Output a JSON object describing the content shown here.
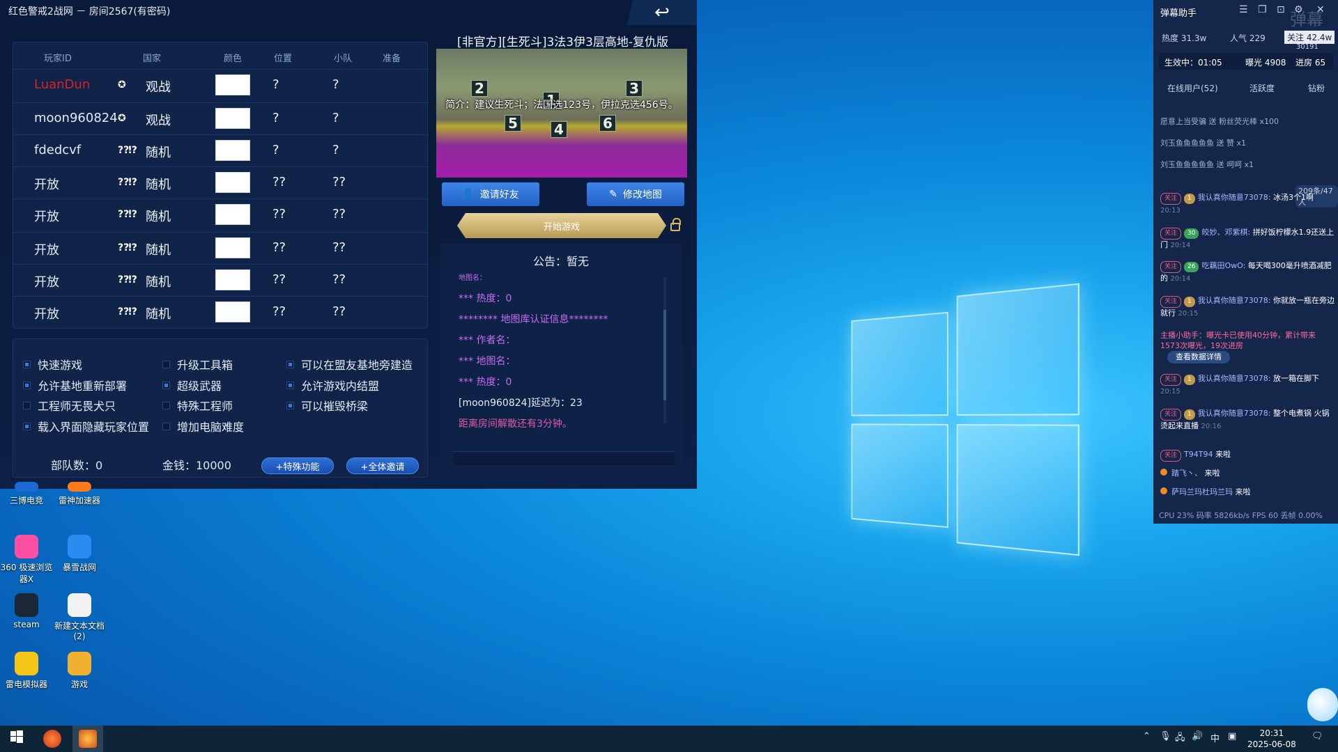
{
  "window_title": "红色警戒2战网 － 房间2567(有密码)",
  "back_glyph": "↩",
  "table_headers": [
    "玩家ID",
    "国家",
    "颜色",
    "位置",
    "小队",
    "准备"
  ],
  "players": [
    {
      "id": "LuanDun",
      "flag": "✪",
      "country": "观战",
      "pos": "?",
      "team": "?"
    },
    {
      "id": "moon960824",
      "flag": "✪",
      "country": "观战",
      "pos": "?",
      "team": "?"
    },
    {
      "id": "fdedcvf",
      "flag": "?⁈?",
      "country": "随机",
      "pos": "?",
      "team": "?"
    },
    {
      "id": "开放",
      "flag": "?⁈?",
      "country": "随机",
      "pos": "??",
      "team": "??"
    },
    {
      "id": "开放",
      "flag": "?⁈?",
      "country": "随机",
      "pos": "??",
      "team": "??"
    },
    {
      "id": "开放",
      "flag": "?⁈?",
      "country": "随机",
      "pos": "??",
      "team": "??"
    },
    {
      "id": "开放",
      "flag": "?⁈?",
      "country": "随机",
      "pos": "??",
      "team": "??"
    },
    {
      "id": "开放",
      "flag": "?⁈?",
      "country": "随机",
      "pos": "??",
      "team": "??"
    }
  ],
  "options": [
    {
      "label": "快速游戏",
      "on": true
    },
    {
      "label": "升级工具箱",
      "on": false
    },
    {
      "label": "可以在盟友基地旁建造",
      "on": true
    },
    {
      "label": "允许基地重新部署",
      "on": true
    },
    {
      "label": "超级武器",
      "on": true
    },
    {
      "label": "允许游戏内结盟",
      "on": true
    },
    {
      "label": "工程师无畏犬只",
      "on": false
    },
    {
      "label": "特殊工程师",
      "on": false
    },
    {
      "label": "可以摧毁桥梁",
      "on": true
    },
    {
      "label": "载入界面隐藏玩家位置",
      "on": true
    },
    {
      "label": "增加电脑难度",
      "on": false
    }
  ],
  "stats": {
    "units": "部队数：0",
    "money": "金钱：10000"
  },
  "buttons": {
    "special": "+特殊功能",
    "invite_all": "+全体邀请",
    "invite_friend": "邀请好友",
    "edit_map": "修改地图",
    "start": "开始游戏"
  },
  "map": {
    "title": "[非官方][生死斗]3法3伊3层高地-复仇版",
    "desc": "简介：建议生死斗；法国选123号，伊拉克选456号。",
    "nums": [
      "2",
      "1",
      "3",
      "5",
      "4",
      "6"
    ]
  },
  "notice": {
    "head": "公告：暂无",
    "lines": [
      {
        "text": "地图名：",
        "color": "#c96cf0"
      },
      {
        "text": "*** 热度：0",
        "color": "#c96cf0"
      },
      {
        "text": "******** 地图库认证信息********",
        "color": "#c96cf0"
      },
      {
        "text": "*** 作者名：",
        "color": "#c96cf0"
      },
      {
        "text": "*** 地图名：",
        "color": "#c96cf0"
      },
      {
        "text": "*** 热度：0",
        "color": "#c96cf0"
      },
      {
        "text": "[moon960824]延迟为：23",
        "color": "#e4ebf6"
      },
      {
        "text": "距离房间解散还有3分钟。",
        "color": "#e05aa8"
      }
    ]
  },
  "desktop_icons": [
    {
      "label": "三博电竞",
      "color": "#1a6bd6"
    },
    {
      "label": "雷神加速器",
      "color": "#ff7a1a"
    },
    {
      "label": "360 极速浏览器X",
      "color": "#ff4fa3"
    },
    {
      "label": "暴雪战网",
      "color": "#2a8cf0"
    },
    {
      "label": "steam",
      "color": "#1b2838"
    },
    {
      "label": "新建文本文档 (2)",
      "color": "#f2f2f2"
    },
    {
      "label": "雷电模拟器",
      "color": "#f5c518"
    },
    {
      "label": "游戏",
      "color": "#f0b030"
    }
  ],
  "panel": {
    "title": "弹幕助手",
    "watermark": "弹幕",
    "heat": "热度 31.3w",
    "popularity": "人气 229",
    "follow": "关注 42.4w",
    "follow_sub": "30191",
    "active": "生效中：01:05",
    "exposure": "曝光 4908",
    "progress": "进房 65",
    "tabs": [
      "在线用户(52)",
      "活跃度",
      "钻粉"
    ],
    "gifts": [
      "愿意上当受骗 送 粉丝荧光棒  x100",
      "刘玉鱼鱼鱼鱼鱼 送 赞  x1",
      "刘玉鱼鱼鱼鱼鱼 送 呵呵  x1"
    ],
    "count_badge": "209条/47人",
    "chats": [
      {
        "tag": "关注",
        "lvl": "1",
        "name": "我认真你随意73078:",
        "msg": "冰汤3个1啊",
        "time": "20:13"
      },
      {
        "tag": "关注",
        "lvl": "30",
        "name": "皎妙、邓紫棋:",
        "msg": "拼好饭柠檬水1.9还送上门",
        "time": "20:14"
      },
      {
        "tag": "关注",
        "lvl": "26",
        "name": "吃藕田OwO:",
        "msg": "每天喝300毫升喷酒减肥的",
        "time": "20:14"
      },
      {
        "tag": "关注",
        "lvl": "1",
        "name": "我认真你随意73078:",
        "msg": "你就放一瓶在旁边就行",
        "time": "20:15"
      },
      {
        "tag": "关注",
        "lvl": "1",
        "name": "我认真你随意73078:",
        "msg": "放一箱在脚下",
        "time": "20:15"
      },
      {
        "tag": "关注",
        "lvl": "1",
        "name": "我认真你随意73078:",
        "msg": "整个电煮锅 火锅烫起来直播",
        "time": "20:16"
      }
    ],
    "system_msg": "主播小助手：曝光卡已使用40分钟，累计带来1573次曝光，19次进房",
    "system_btn": "查看数据详情",
    "entries": [
      {
        "tag": "关注",
        "name": "T94T94",
        "msg": "来啦"
      },
      {
        "tag": "",
        "name": "踏飞丶、",
        "msg": "来啦"
      },
      {
        "tag": "",
        "name": "萨玛兰玛杜玛兰玛",
        "msg": "来啦"
      }
    ],
    "cpu": "CPU 23%  码率 5826kb/s  FPS 60  丢帧 0.00%"
  },
  "taskbar": {
    "ime": "中",
    "time": "20:31",
    "date": "2025-06-08"
  },
  "colors": {
    "accent": "#2d7de6",
    "red_player": "#e02020",
    "gold": "#d8b85a"
  }
}
